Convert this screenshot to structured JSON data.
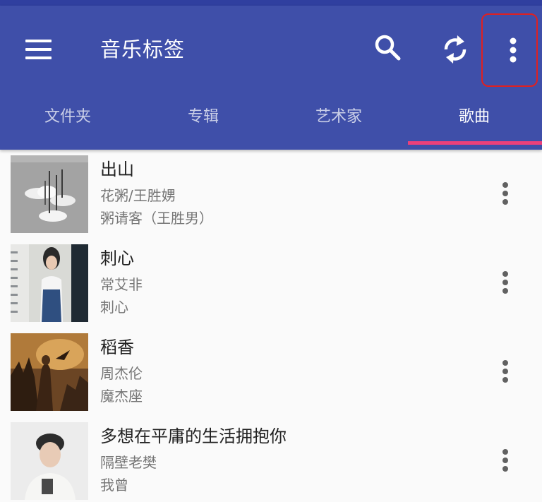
{
  "colors": {
    "primary": "#3f4fa9",
    "primary_dark": "#303f9f",
    "accent": "#ec407a",
    "highlight": "#e02020"
  },
  "app_bar": {
    "title": "音乐标签",
    "icons": [
      "menu-icon",
      "search-icon",
      "sync-icon",
      "more-vert-icon"
    ]
  },
  "tabs": [
    {
      "label": "文件夹",
      "active": false
    },
    {
      "label": "专辑",
      "active": false
    },
    {
      "label": "艺术家",
      "active": false
    },
    {
      "label": "歌曲",
      "active": true
    }
  ],
  "songs": [
    {
      "title": "出山",
      "artist": "花粥/王胜娚",
      "album": "粥请客（王胜男）"
    },
    {
      "title": "刺心",
      "artist": "常艾非",
      "album": "刺心"
    },
    {
      "title": "稻香",
      "artist": "周杰伦",
      "album": "魔杰座"
    },
    {
      "title": "多想在平庸的生活拥抱你",
      "artist": "隔壁老樊",
      "album": "我曾"
    }
  ]
}
